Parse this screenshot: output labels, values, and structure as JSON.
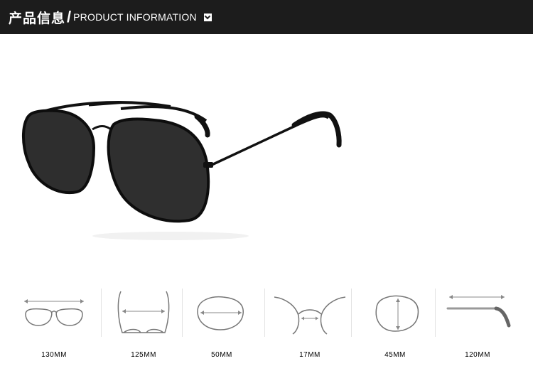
{
  "header": {
    "title_cn": "产品信息",
    "slash": "/",
    "title_en": "PRODUCT INFORMATION",
    "icon": "chevron-down-icon"
  },
  "product": {
    "icon": "aviator-sunglasses-image"
  },
  "specs": [
    {
      "icon": "total-width-icon",
      "label": "130MM"
    },
    {
      "icon": "temple-spread-icon",
      "label": "125MM"
    },
    {
      "icon": "lens-width-icon",
      "label": "50MM"
    },
    {
      "icon": "bridge-width-icon",
      "label": "17MM"
    },
    {
      "icon": "lens-height-icon",
      "label": "45MM"
    },
    {
      "icon": "temple-length-icon",
      "label": "120MM"
    }
  ],
  "colors": {
    "header_bg": "#1c1c1c",
    "frame": "#111111",
    "lens": "#2e2e2e",
    "diagram": "#777777"
  }
}
